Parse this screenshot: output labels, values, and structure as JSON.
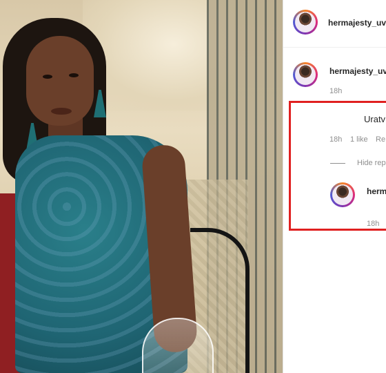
{
  "post": {
    "header_username": "hermajesty_uv",
    "caption_username": "hermajesty_uv",
    "caption_time": "18h"
  },
  "comment": {
    "text": "Uratv",
    "time": "18h",
    "likes": "1 like",
    "reply": "Re",
    "hide_replies": "Hide rep"
  },
  "reply": {
    "username": "herm",
    "time": "18h"
  },
  "colors": {
    "highlight_border": "#e02020",
    "username": "#262626",
    "meta": "#8e8e8e"
  }
}
